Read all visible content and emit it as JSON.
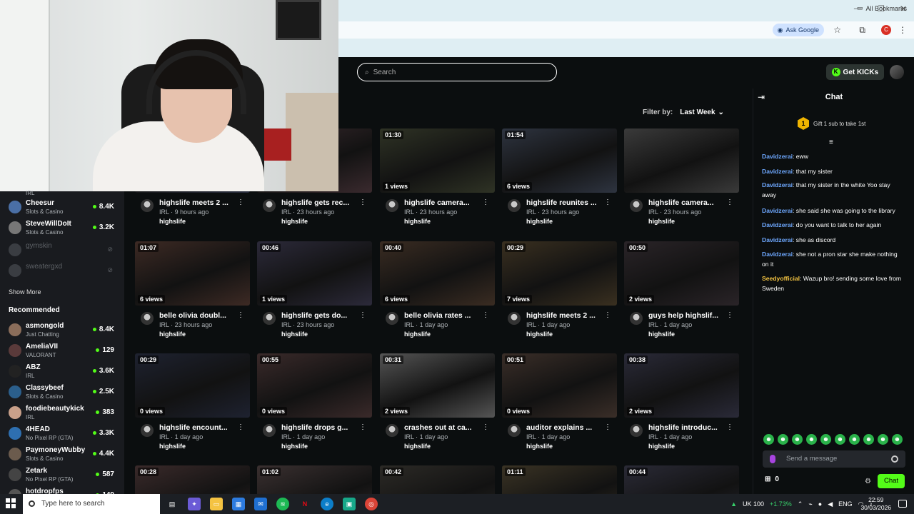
{
  "browser": {
    "ask_google": "Ask Google",
    "all_bookmarks": "All Bookmarks",
    "profile_initial": "C",
    "window_controls": [
      "—",
      "❐",
      "✕"
    ]
  },
  "header": {
    "search_placeholder": "Search",
    "get_kicks": "Get KICKs"
  },
  "filter": {
    "label": "Filter by:",
    "value": "Last Week"
  },
  "sidebar": {
    "top_partial": {
      "category": "IRL"
    },
    "following": [
      {
        "name": "Cheesur",
        "category": "Slots & Casino",
        "viewers": "8.4K",
        "avatar_color": "#4a6fa5"
      },
      {
        "name": "SteveWillDoIt",
        "category": "Slots & Casino",
        "viewers": "3.2K",
        "avatar_color": "#777777"
      },
      {
        "name": "gymskin",
        "category": "",
        "viewers": "",
        "avatar_color": "#3a3d42",
        "offline": true
      },
      {
        "name": "sweatergxd",
        "category": "",
        "viewers": "",
        "avatar_color": "#3a3d42",
        "offline": true
      }
    ],
    "show_more": "Show More",
    "recommended_heading": "Recommended",
    "recommended": [
      {
        "name": "asmongold",
        "category": "Just Chatting",
        "viewers": "8.4K",
        "avatar_color": "#8a6d5a"
      },
      {
        "name": "AmeliaVII",
        "category": "VALORANT",
        "viewers": "129",
        "avatar_color": "#5a3a3a"
      },
      {
        "name": "ABZ",
        "category": "IRL",
        "viewers": "3.6K",
        "avatar_color": "#222222"
      },
      {
        "name": "Classybeef",
        "category": "Slots & Casino",
        "viewers": "2.5K",
        "avatar_color": "#2b5f8c"
      },
      {
        "name": "foodiebeautykick",
        "category": "IRL",
        "viewers": "383",
        "avatar_color": "#c9a08a"
      },
      {
        "name": "4HEAD",
        "category": "No Pixel RP (GTA)",
        "viewers": "3.3K",
        "avatar_color": "#2e6fb0"
      },
      {
        "name": "PaymoneyWubby",
        "category": "Slots & Casino",
        "viewers": "4.4K",
        "avatar_color": "#6b5b4d"
      },
      {
        "name": "Zetark",
        "category": "No Pixel RP (GTA)",
        "viewers": "587",
        "avatar_color": "#444444"
      },
      {
        "name": "hotdropfps",
        "category": "",
        "viewers": "149",
        "avatar_color": "#555555"
      }
    ]
  },
  "videos": {
    "row1": [
      {
        "duration": "",
        "views": "",
        "title": "highslife meets 2 ...",
        "sub": "IRL · 9 hours ago",
        "channel": "highslife",
        "tone": "#2a2f40"
      },
      {
        "duration": "00:27",
        "views": "4 views",
        "title": "highslife gets rec...",
        "sub": "IRL · 23 hours ago",
        "channel": "highslife",
        "tone": "#3a2a2e"
      },
      {
        "duration": "01:30",
        "views": "1 views",
        "title": "highslife camera...",
        "sub": "IRL · 23 hours ago",
        "channel": "highslife",
        "tone": "#2f3325"
      },
      {
        "duration": "01:54",
        "views": "6 views",
        "title": "highslife reunites ...",
        "sub": "IRL · 23 hours ago",
        "channel": "highslife",
        "tone": "#2e3440"
      },
      {
        "duration": "",
        "views": "",
        "title": "highslife camera...",
        "sub": "IRL · 23 hours ago",
        "channel": "highslife",
        "tone": "#3a3a3a"
      }
    ],
    "row2": [
      {
        "duration": "01:07",
        "views": "6 views",
        "title": "belle olivia doubl...",
        "sub": "IRL · 23 hours ago",
        "channel": "highslife",
        "tone": "#3d2a24"
      },
      {
        "duration": "00:46",
        "views": "1 views",
        "title": "highslife gets do...",
        "sub": "IRL · 23 hours ago",
        "channel": "highslife",
        "tone": "#2c2a3a"
      },
      {
        "duration": "00:40",
        "views": "6 views",
        "title": "belle olivia rates ...",
        "sub": "IRL · 1 day ago",
        "channel": "highslife",
        "tone": "#3a2c22"
      },
      {
        "duration": "00:29",
        "views": "7 views",
        "title": "highslife meets 2 ...",
        "sub": "IRL · 1 day ago",
        "channel": "highslife",
        "tone": "#3a3020"
      },
      {
        "duration": "00:50",
        "views": "2 views",
        "title": "guys help highslif...",
        "sub": "IRL · 1 day ago",
        "channel": "highslife",
        "tone": "#2a2428"
      }
    ],
    "row3": [
      {
        "duration": "00:29",
        "views": "0 views",
        "title": "highslife encount...",
        "sub": "IRL · 1 day ago",
        "channel": "highslife",
        "tone": "#1e2230"
      },
      {
        "duration": "00:55",
        "views": "0 views",
        "title": "highslife drops g...",
        "sub": "IRL · 1 day ago",
        "channel": "highslife",
        "tone": "#3a2a2a"
      },
      {
        "duration": "00:31",
        "views": "2 views",
        "title": "crashes out at ca...",
        "sub": "IRL · 1 day ago",
        "channel": "highslife",
        "tone": "#555555"
      },
      {
        "duration": "00:51",
        "views": "0 views",
        "title": "auditor explains ...",
        "sub": "IRL · 1 day ago",
        "channel": "highslife",
        "tone": "#3a2e28"
      },
      {
        "duration": "00:38",
        "views": "2 views",
        "title": "highslife introduc...",
        "sub": "IRL · 1 day ago",
        "channel": "highslife",
        "tone": "#2a2a38"
      }
    ],
    "row4": [
      {
        "duration": "00:28",
        "tone": "#3a2a2a"
      },
      {
        "duration": "01:02",
        "tone": "#3a3030"
      },
      {
        "duration": "00:42",
        "tone": "#2c2a26"
      },
      {
        "duration": "01:11",
        "tone": "#3a3324"
      },
      {
        "duration": "00:44",
        "tone": "#2a2a36"
      }
    ]
  },
  "chat": {
    "title": "Chat",
    "gift_text": "Gift 1 sub to take 1st",
    "gift_count": "1",
    "messages": [
      {
        "user": "Davidzerai",
        "text": ": eww",
        "color": "#6ea8ff"
      },
      {
        "user": "Davidzerai",
        "text": ": that my sister",
        "color": "#6ea8ff"
      },
      {
        "user": "Davidzerai",
        "text": ": that my sister in the white Yoo stay away",
        "color": "#6ea8ff"
      },
      {
        "user": "Davidzerai",
        "text": ": she said she was going to the library",
        "color": "#6ea8ff"
      },
      {
        "user": "Davidzerai",
        "text": ": do you want to talk to her again",
        "color": "#6ea8ff"
      },
      {
        "user": "Davidzerai",
        "text": ": she as discord",
        "color": "#6ea8ff"
      },
      {
        "user": "Davidzerai",
        "text": ": she not a pron star she make nothing on it",
        "color": "#6ea8ff"
      },
      {
        "user": "Seedyofficial",
        "text": ": Wazup bro! sending some love from Sweden",
        "color": "#f5c542"
      }
    ],
    "input_placeholder": "Send a message",
    "kicks_count": "0",
    "send_label": "Chat"
  },
  "taskbar": {
    "search_placeholder": "Type here to search",
    "ticker": "UK 100",
    "ticker_change": "+1.73%",
    "lang": "ENG",
    "time": "22:59",
    "date": "30/03/2026"
  }
}
